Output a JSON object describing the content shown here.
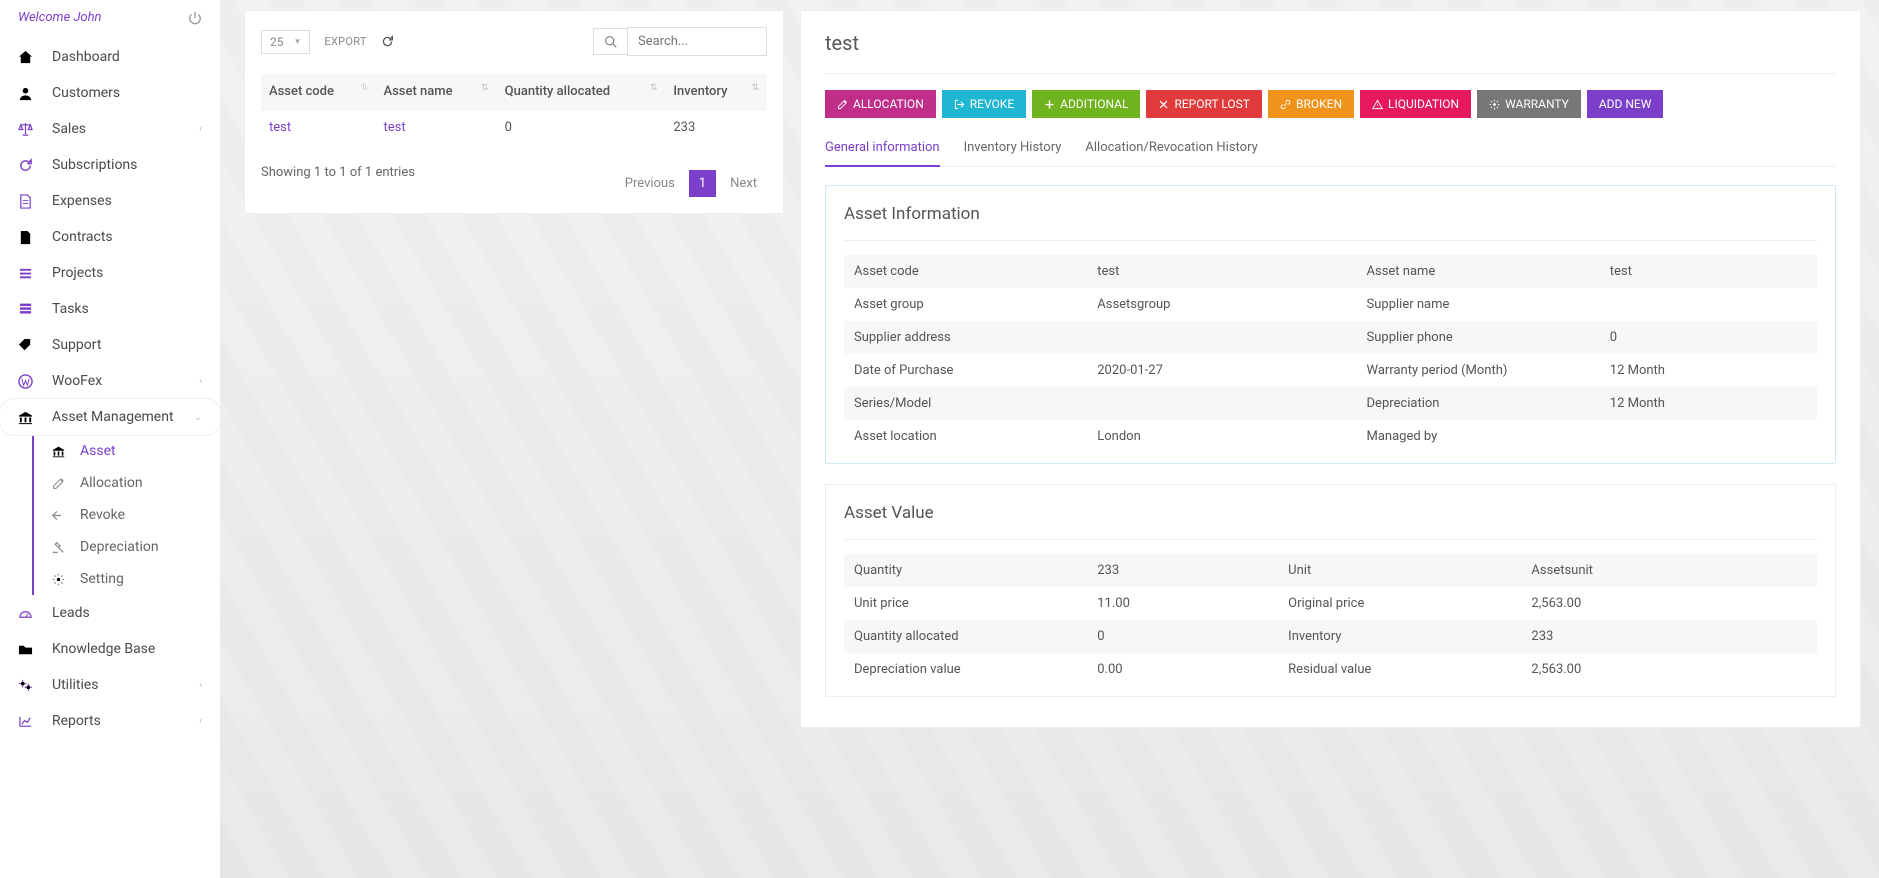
{
  "header": {
    "welcome": "Welcome John"
  },
  "nav": [
    {
      "icon": "home",
      "label": "Dashboard"
    },
    {
      "icon": "user",
      "label": "Customers"
    },
    {
      "icon": "scale",
      "label": "Sales",
      "chev": true
    },
    {
      "icon": "refresh",
      "label": "Subscriptions"
    },
    {
      "icon": "file",
      "label": "Expenses"
    },
    {
      "icon": "doc",
      "label": "Contracts"
    },
    {
      "icon": "menu",
      "label": "Projects"
    },
    {
      "icon": "list",
      "label": "Tasks"
    },
    {
      "icon": "tag",
      "label": "Support"
    },
    {
      "icon": "wp",
      "label": "WooFex",
      "chev": true
    },
    {
      "icon": "bank",
      "label": "Asset Management",
      "chev": true,
      "active": true
    }
  ],
  "subnav": [
    {
      "icon": "bank",
      "label": "Asset",
      "cur": true
    },
    {
      "icon": "edit",
      "label": "Allocation"
    },
    {
      "icon": "back",
      "label": "Revoke"
    },
    {
      "icon": "gavel",
      "label": "Depreciation"
    },
    {
      "icon": "cog",
      "label": "Setting"
    }
  ],
  "nav2": [
    {
      "icon": "gauge",
      "label": "Leads"
    },
    {
      "icon": "folder",
      "label": "Knowledge Base"
    },
    {
      "icon": "cogs",
      "label": "Utilities",
      "chev": true
    },
    {
      "icon": "chart",
      "label": "Reports",
      "chev": true
    }
  ],
  "list": {
    "page_size": "25",
    "export": "EXPORT",
    "search_placeholder": "Search...",
    "cols": [
      "Asset code",
      "Asset name",
      "Quantity allocated",
      "Inventory"
    ],
    "row": {
      "code": "test",
      "name": "test",
      "qty": "0",
      "inv": "233"
    },
    "showing": "Showing 1 to 1 of 1 entries",
    "prev": "Previous",
    "page": "1",
    "next": "Next"
  },
  "detail": {
    "title": "test",
    "buttons": {
      "allocation": "ALLOCATION",
      "revoke": "REVOKE",
      "additional": "ADDITIONAL",
      "report": "REPORT LOST",
      "broken": "BROKEN",
      "liquidation": "LIQUIDATION",
      "warranty": "WARRANTY",
      "addnew": "ADD NEW"
    },
    "tabs": [
      "General information",
      "Inventory History",
      "Allocation/Revocation History"
    ],
    "info_title": "Asset Information",
    "info": [
      [
        "Asset code",
        "test",
        "Asset name",
        "test"
      ],
      [
        "Asset group",
        "Assetsgroup",
        "Supplier name",
        ""
      ],
      [
        "Supplier address",
        "",
        "Supplier phone",
        "0"
      ],
      [
        "Date of Purchase",
        "2020-01-27",
        "Warranty period (Month)",
        "12 Month"
      ],
      [
        "Series/Model",
        "",
        "Depreciation",
        "12 Month"
      ],
      [
        "Asset location",
        "London",
        "Managed by",
        ""
      ]
    ],
    "val_title": "Asset Value",
    "val": [
      [
        "Quantity",
        "233",
        "Unit",
        "Assetsunit"
      ],
      [
        "Unit price",
        "11.00",
        "Original price",
        "2,563.00"
      ],
      [
        "Quantity allocated",
        "0",
        "Inventory",
        "233"
      ],
      [
        "Depreciation value",
        "0.00",
        "Residual value",
        "2,563.00"
      ]
    ]
  }
}
